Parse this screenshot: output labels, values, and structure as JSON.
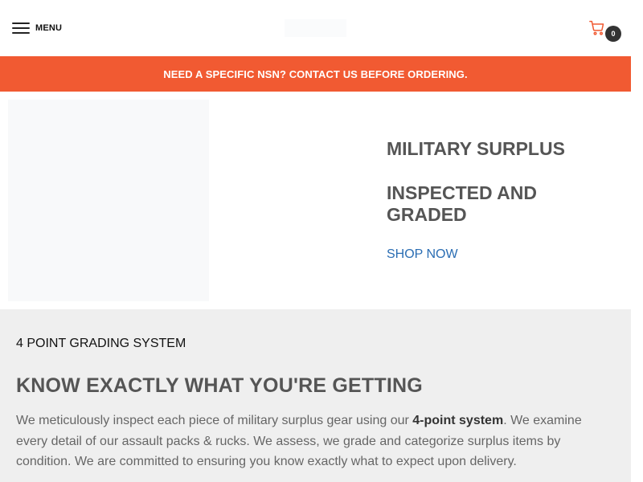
{
  "header": {
    "menu_label": "MENU",
    "cart_count": "0"
  },
  "announcement": {
    "text": "NEED A SPECIFIC NSN? CONTACT US BEFORE ORDERING."
  },
  "hero": {
    "title": "MILITARY SURPLUS",
    "subtitle": "INSPECTED AND GRADED",
    "cta_label": "SHOP NOW"
  },
  "grading": {
    "eyebrow": "4 POINT GRADING SYSTEM",
    "title": "KNOW EXACTLY WHAT YOU'RE GETTING",
    "body_part1": "We meticulously inspect each piece of military surplus gear using our ",
    "body_strong": "4-point system",
    "body_part2": ". We examine every detail of our assault packs & rucks. We assess, we grade and categorize surplus items by condition. We are committed to ensuring you know exactly what to expect upon delivery."
  },
  "colors": {
    "accent": "#f15a32",
    "link": "#2a6db3",
    "badge": "#333333",
    "section_bg": "#efefef"
  },
  "icons": {
    "menu": "hamburger-icon",
    "cart": "cart-icon"
  }
}
